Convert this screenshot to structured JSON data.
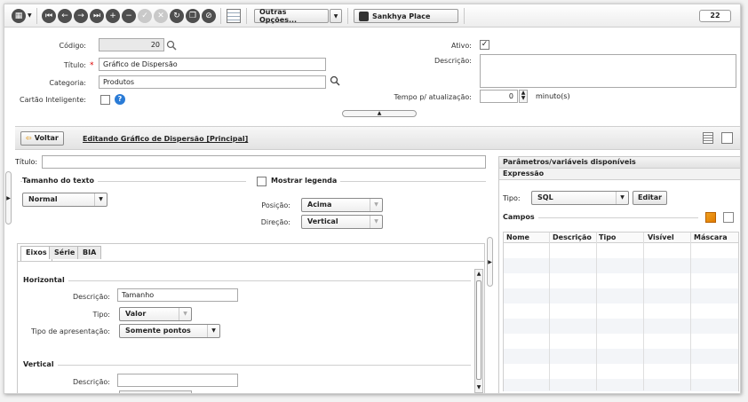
{
  "toolbar": {
    "more_options_label": "Outras Opções...",
    "place_label": "Sankhya Place",
    "badge_count": "22",
    "icons": [
      "grid-menu-icon",
      "first-record-icon",
      "previous-record-icon",
      "next-record-icon",
      "last-record-icon",
      "add-icon",
      "remove-icon",
      "confirm-icon",
      "cancel-icon",
      "refresh-icon",
      "copy-icon",
      "attach-icon",
      "spreadsheet-icon"
    ]
  },
  "form": {
    "codigo_label": "Código:",
    "codigo_value": "20",
    "titulo_label": "Título:",
    "titulo_value": "Gráfico de Dispersão",
    "categoria_label": "Categoria:",
    "categoria_value": "Produtos",
    "cartao_label": "Cartão Inteligente:",
    "ativo_label": "Ativo:",
    "descricao_label": "Descrição:",
    "tempo_label": "Tempo p/ atualização:",
    "tempo_value": "0",
    "tempo_unit": "minuto(s)",
    "help_symbol": "?"
  },
  "editbar": {
    "back_label": "Voltar",
    "editing_label": "Editando Gráfico de Dispersão [Principal]"
  },
  "chart_editor": {
    "titulo_label": "Título:",
    "text_size_title": "Tamanho do texto",
    "text_size_value": "Normal",
    "legend_label": "Mostrar legenda",
    "posicao_label": "Posição:",
    "posicao_value": "Acima",
    "direcao_label": "Direção:",
    "direcao_value": "Vertical",
    "tabs": [
      "Eixos",
      "Série",
      "BIA"
    ],
    "horizontal_title": "Horizontal",
    "h_descricao_label": "Descrição:",
    "h_descricao_value": "Tamanho",
    "h_tipo_label": "Tipo:",
    "h_tipo_value": "Valor",
    "h_apresentacao_label": "Tipo de apresentação:",
    "h_apresentacao_value": "Somente pontos",
    "vertical_title": "Vertical",
    "v_descricao_label": "Descrição:"
  },
  "params_panel": {
    "title": "Parâmetros/variáveis disponíveis",
    "expressao_label": "Expressão",
    "tipo_label": "Tipo:",
    "tipo_value": "SQL",
    "edit_label": "Editar",
    "campos_label": "Campos",
    "columns": [
      "Nome",
      "Descrição",
      "Tipo",
      "Visível",
      "Máscara"
    ]
  }
}
